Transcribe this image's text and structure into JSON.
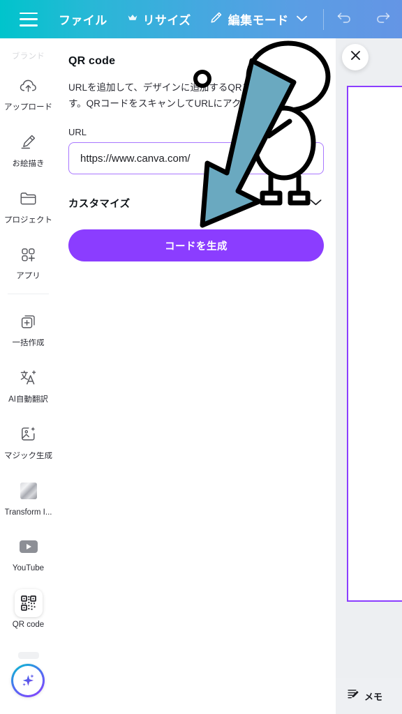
{
  "topbar": {
    "menu_icon": "hamburger-icon",
    "file_label": "ファイル",
    "resize_label": "リサイズ",
    "resize_icon": "crown-icon",
    "mode_label": "編集モード",
    "mode_icon": "pencil-icon",
    "mode_chevron": "chevron-down-icon",
    "undo_icon": "undo-arrow-icon",
    "redo_icon": "redo-arrow-icon",
    "gradient_start": "#00c4cc",
    "gradient_end": "#6495e5"
  },
  "sidebar": {
    "section_label": "ブランド",
    "items": [
      {
        "label": "アップロード",
        "icon": "upload-cloud-icon",
        "selected": false
      },
      {
        "label": "お絵描き",
        "icon": "draw-pen-icon",
        "selected": false
      },
      {
        "label": "プロジェクト",
        "icon": "folder-icon",
        "selected": false
      },
      {
        "label": "アプリ",
        "icon": "apps-grid-plus-icon",
        "selected": false
      },
      {
        "label": "一括作成",
        "icon": "bulk-create-icon",
        "selected": false
      },
      {
        "label": "AI自動翻訳",
        "icon": "translate-icon",
        "selected": false
      },
      {
        "label": "マジック生成",
        "icon": "magic-media-icon",
        "selected": false
      },
      {
        "label": "Transform I...",
        "icon": "transform-thumbnail-icon",
        "selected": false
      },
      {
        "label": "YouTube",
        "icon": "youtube-icon",
        "selected": false
      },
      {
        "label": "QR code",
        "icon": "qr-code-icon",
        "selected": true
      }
    ],
    "magic_button": {
      "icon": "sparkle-magic-icon",
      "gradient_start": "#00c4cc",
      "gradient_end": "#8b3dff"
    }
  },
  "panel": {
    "title": "QR code",
    "description": "URLを追加して、デザインに追加するQRコードを作成します。QRコードをスキャンしてURLにアクセスできます。",
    "url_field": {
      "label": "URL",
      "value": "https://www.canva.com/",
      "placeholder": "https://www.canva.com/",
      "border_color": "#a977ff"
    },
    "customize": {
      "label": "カスタマイズ",
      "chevron": "chevron-down-icon"
    },
    "generate_button": {
      "label": "コードを生成",
      "color": "#8b3dff"
    },
    "close_button": {
      "icon": "close-icon"
    }
  },
  "canvas": {
    "page_border_color": "#8b3dff",
    "memo": {
      "label": "メモ",
      "icon": "notes-pencil-icon"
    }
  },
  "overlay": {
    "arrow_color": "#6aa9c0",
    "character": "stick-figure-illustration"
  }
}
